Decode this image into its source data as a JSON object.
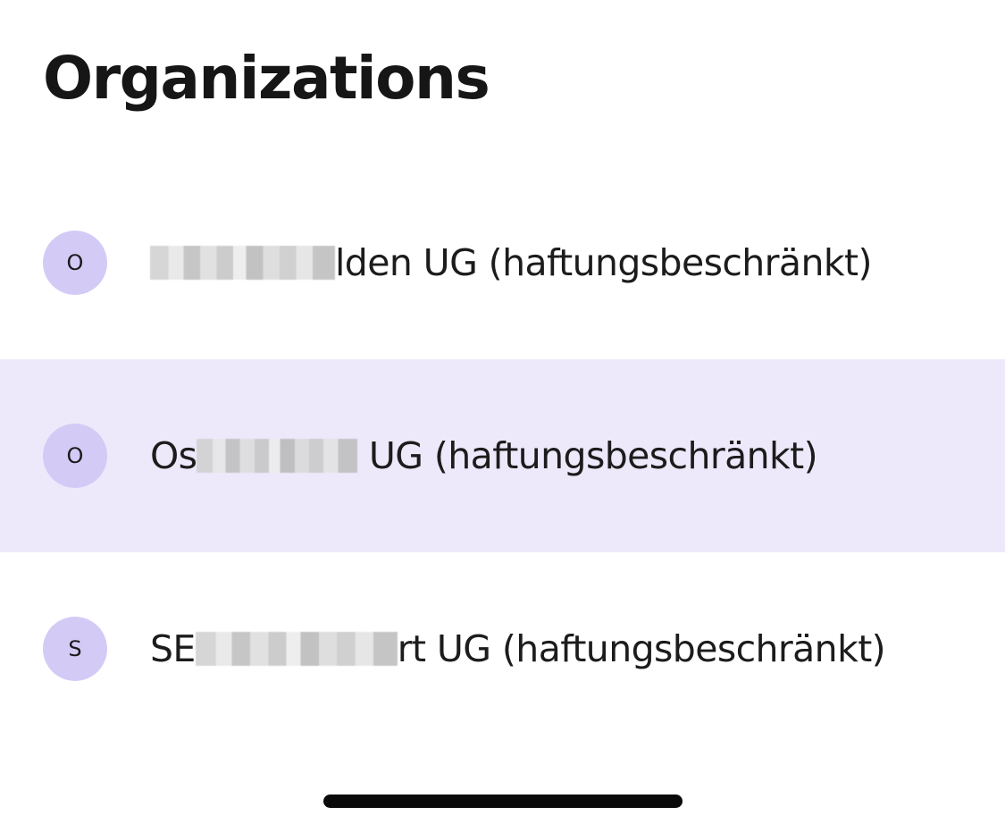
{
  "page": {
    "title": "Organizations"
  },
  "organizations": [
    {
      "initial": "O",
      "name_prefix": "",
      "name_suffix": "lden UG (haftungsbeschränkt)",
      "selected": false
    },
    {
      "initial": "O",
      "name_prefix": "Os",
      "name_suffix": " UG (haftungsbeschränkt)",
      "selected": true
    },
    {
      "initial": "S",
      "name_prefix": "SE",
      "name_suffix": "rt UG (haftungsbeschränkt)",
      "selected": false
    }
  ],
  "colors": {
    "selected_row_background": "#ede9fb",
    "avatar_background": "#d3cbf6",
    "text": "#1a1a1a"
  }
}
